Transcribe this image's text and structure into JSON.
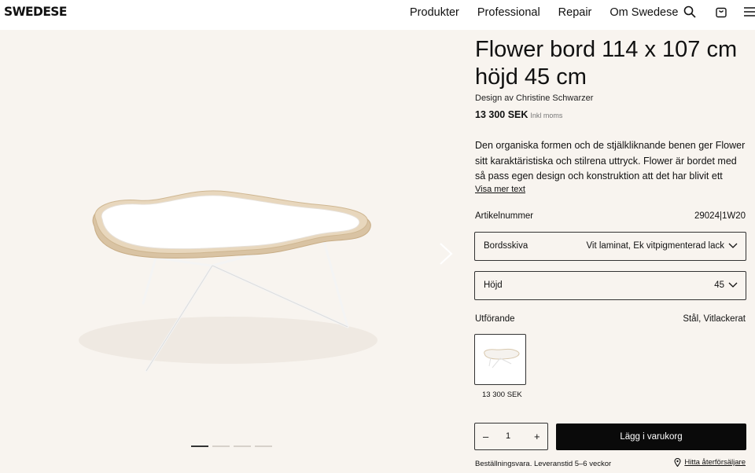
{
  "header": {
    "logo": "SWEDESE",
    "nav": [
      "Produkter",
      "Professional",
      "Repair",
      "Om Swedese"
    ],
    "icons": [
      "search-icon",
      "cart-icon",
      "menu-icon"
    ]
  },
  "gallery": {
    "image": "flower-table-image",
    "slides": 4,
    "active_slide": 1
  },
  "product": {
    "title": "Flower bord 114 x 107 cm höjd 45 cm",
    "designer": "Design av Christine Schwarzer",
    "price": "13 300 SEK",
    "price_note": "Inkl moms",
    "description": "Den organiska formen och de stjälkliknande benen ger Flower sitt karaktäristiska och stilrena uttryck. Flower är bordet med så pass egen design och konstruktion att det har blivit ett signum...",
    "more_link": "Visa mer text",
    "article_label": "Artikelnummer",
    "article_value": "29024|1W20",
    "tabletop_label": "Bordsskiva",
    "tabletop_value": "Vit laminat, Ek vitpigmenterad lack",
    "height_label": "Höjd",
    "height_value": "45",
    "finish_label": "Utförande",
    "finish_value": "Stål, Vitlackerat",
    "swatch_price": "13 300 SEK",
    "qty_minus": "–",
    "qty_value": "1",
    "qty_plus": "+",
    "add_to_cart": "Lägg i varukorg",
    "delivery": "Beställningsvara. Leveranstid 5–6 veckor",
    "find_retailer": "Hitta återförsäljare"
  },
  "colors": {
    "background": "#f8f4ef",
    "button": "#0a0a0a",
    "text": "#111111"
  }
}
